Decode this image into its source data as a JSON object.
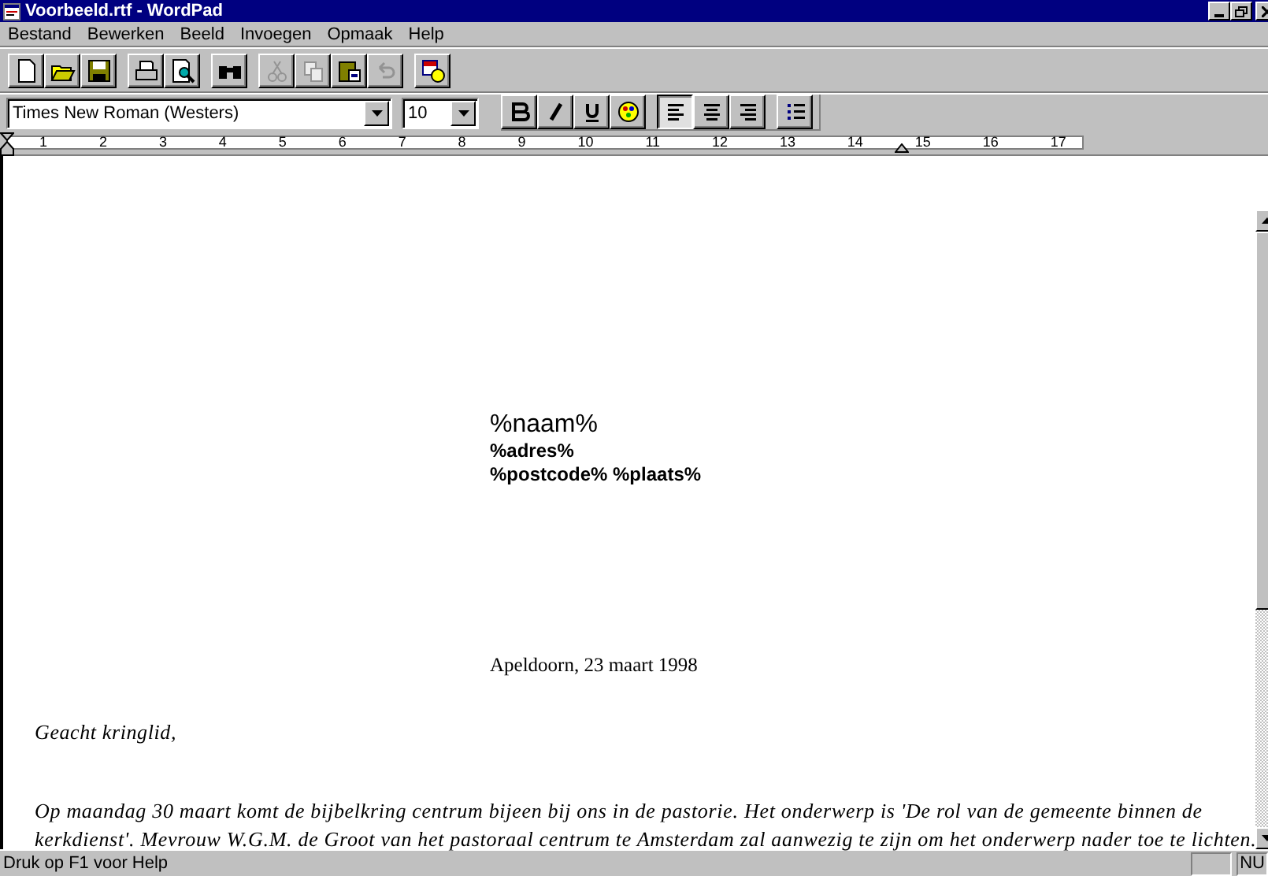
{
  "window": {
    "title": "Voorbeeld.rtf - WordPad"
  },
  "menu": [
    {
      "label": "Bestand"
    },
    {
      "label": "Bewerken"
    },
    {
      "label": "Beeld"
    },
    {
      "label": "Invoegen"
    },
    {
      "label": "Opmaak"
    },
    {
      "label": "Help"
    }
  ],
  "toolbar": [
    {
      "kind": "new",
      "disabled": false
    },
    {
      "kind": "open",
      "disabled": false
    },
    {
      "kind": "save",
      "disabled": false
    },
    {
      "kind": "sep"
    },
    {
      "kind": "print",
      "disabled": false
    },
    {
      "kind": "preview",
      "disabled": false
    },
    {
      "kind": "sep"
    },
    {
      "kind": "find",
      "disabled": false
    },
    {
      "kind": "sep"
    },
    {
      "kind": "cut",
      "disabled": true
    },
    {
      "kind": "copy",
      "disabled": true
    },
    {
      "kind": "paste",
      "disabled": false
    },
    {
      "kind": "undo",
      "disabled": true
    },
    {
      "kind": "sep"
    },
    {
      "kind": "date",
      "disabled": false
    }
  ],
  "format_bar": {
    "font": "Times New Roman (Westers)",
    "size": "10",
    "buttons": [
      {
        "kind": "bold",
        "selected": false
      },
      {
        "kind": "italic",
        "selected": false
      },
      {
        "kind": "underline",
        "selected": false
      },
      {
        "kind": "color",
        "selected": false
      },
      {
        "kind": "sep"
      },
      {
        "kind": "left",
        "selected": true
      },
      {
        "kind": "center",
        "selected": false
      },
      {
        "kind": "right",
        "selected": false
      },
      {
        "kind": "sep"
      },
      {
        "kind": "bullets",
        "selected": false
      }
    ]
  },
  "ruler": {
    "numbers": [
      "1",
      "2",
      "3",
      "4",
      "5",
      "6",
      "7",
      "8",
      "9",
      "10",
      "11",
      "12",
      "13",
      "14",
      "15",
      "16",
      "17"
    ]
  },
  "document": {
    "address": [
      "%naam%",
      "%adres%",
      "%postcode%  %plaats%"
    ],
    "date": "Apeldoorn, 23 maart 1998",
    "salutation": "Geacht kringlid,",
    "paragraph": [
      "Op maandag 30 maart komt de bijbelkring centrum bijeen bij ons in de pastorie. Het onderwerp is 'De rol van de gemeente binnen de",
      "kerkdienst'. Mevrouw W.G.M. de Groot van het pastoraal centrum te Amsterdam zal aanwezig te zijn om het onderwerp nader toe te lichten."
    ]
  },
  "status_bar": {
    "text": "Druk op F1 voor Help",
    "num": "NU"
  }
}
